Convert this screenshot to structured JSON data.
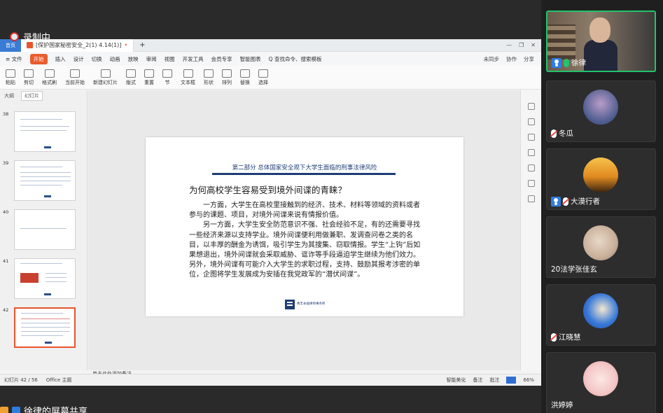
{
  "recording": {
    "label": "录制中"
  },
  "wps": {
    "titlebar": {
      "home": "首页",
      "tab_title": "[保护国家秘密安全_2(1) 4.14(1)]",
      "modified": "•",
      "new_tab": "+"
    },
    "menubar": {
      "items": [
        "≡ 文件",
        "开始",
        "插入",
        "设计",
        "切换",
        "动画",
        "放映",
        "审阅",
        "视图",
        "开发工具",
        "会员专享",
        "智能图表",
        "Q 查找命令、搜索模板"
      ],
      "active": "开始",
      "right": [
        "未同步",
        "协作",
        "分享"
      ]
    },
    "ribbon": {
      "items": [
        "粘贴",
        "剪切",
        "格式刷",
        "当前开始",
        "新建幻灯片",
        "版式",
        "重置",
        "节",
        "文本框",
        "形状",
        "排列",
        "替换",
        "选择"
      ]
    },
    "thumbnail_panel": {
      "tabs": [
        "大纲",
        "幻灯片"
      ],
      "slides": [
        {
          "number": "38"
        },
        {
          "number": "39"
        },
        {
          "number": "40"
        },
        {
          "number": "41"
        },
        {
          "number": "42"
        }
      ],
      "add_label": "+"
    },
    "slide": {
      "header": "第二部分 总体国家安全观下大学生面临的刑事法律风险",
      "title": "为何高校学生容易受到境外间谍的青睐？",
      "paragraphs": [
        "一方面，大学生在高校里接触到的经济、技术、材料等领域的资料或者参与的课题、项目，对境外间谍来说有情报价值。",
        "另一方面，大学生安全防范意识不强、社会经验不足，有的还需要寻找一些经济来源以支持学业。境外间谍便利用做兼职、发调查问卷之类的名目，以丰厚的酬金为诱饵，吸引学生为其搜集、窃取情报。学生“上钩”后如果想退出，境外间谍就会采取威胁、诓诈等手段逼迫学生继续为他们效力。另外，境外间谍有可能介入大学生的求职过程，支持、鼓励其报考涉密的单位，企图将学生发展成为安插在我党政军的“潜伏间谍”。"
      ],
      "logo_text": "秀丰永福律师事务所"
    },
    "notes_placeholder": "单击此处添加备注",
    "statusbar": {
      "page": "幻灯片 42 / 56",
      "theme": "Office 主题",
      "smart": "智能美化",
      "notes": "备注",
      "comments": "批注",
      "zoom": "66%"
    }
  },
  "presenter_bar": {
    "label": "徐律的屏幕共享"
  },
  "participants": [
    {
      "name": "徐律",
      "host": true,
      "mic": "on",
      "video": true
    },
    {
      "name": "冬瓜",
      "host": false,
      "mic": "muted",
      "avatar_color": "#4a5a8c"
    },
    {
      "name": "大漠行者",
      "host": true,
      "mic": "muted",
      "avatar_color": "#f0a030"
    },
    {
      "name": "20法学张佳玄",
      "host": false,
      "mic": "none",
      "avatar_color": "#d8c8b8"
    },
    {
      "name": "江晓慧",
      "host": false,
      "mic": "muted",
      "avatar_color": "#1a5cc8"
    },
    {
      "name": "洪婷婷",
      "host": false,
      "mic": "none",
      "avatar_color": "#f3d6d6"
    }
  ]
}
